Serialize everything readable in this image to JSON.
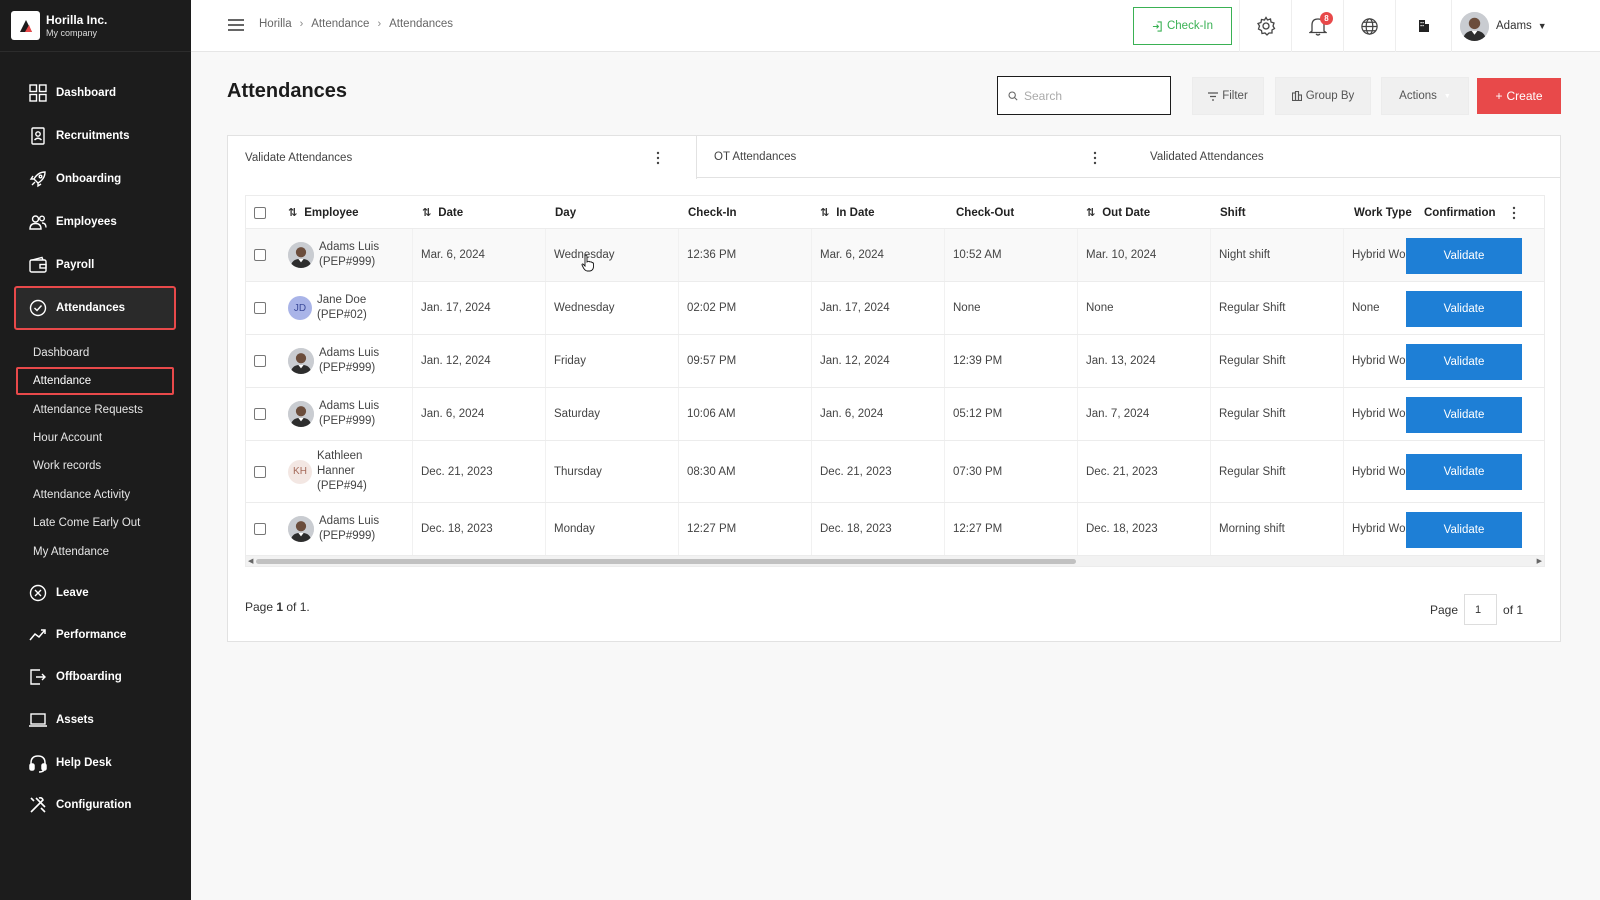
{
  "brand": {
    "company": "Horilla Inc.",
    "subtitle": "My company"
  },
  "sidebar": {
    "items": [
      {
        "label": "Dashboard",
        "icon": "dashboard-icon"
      },
      {
        "label": "Recruitments",
        "icon": "recruitment-icon"
      },
      {
        "label": "Onboarding",
        "icon": "rocket-icon"
      },
      {
        "label": "Employees",
        "icon": "users-icon"
      },
      {
        "label": "Payroll",
        "icon": "wallet-icon"
      },
      {
        "label": "Attendances",
        "icon": "check-circle-icon",
        "active": true
      },
      {
        "label": "Leave",
        "icon": "close-circle-icon"
      },
      {
        "label": "Performance",
        "icon": "trend-icon"
      },
      {
        "label": "Offboarding",
        "icon": "exit-icon"
      },
      {
        "label": "Assets",
        "icon": "laptop-icon"
      },
      {
        "label": "Help Desk",
        "icon": "headset-icon"
      },
      {
        "label": "Configuration",
        "icon": "tools-icon"
      }
    ],
    "attendance_submenu": [
      "Dashboard",
      "Attendance",
      "Attendance Requests",
      "Hour Account",
      "Work records",
      "Attendance Activity",
      "Late Come Early Out",
      "My Attendance"
    ],
    "active_submenu": "Attendance"
  },
  "topbar": {
    "breadcrumb": [
      "Horilla",
      "Attendance",
      "Attendances"
    ],
    "checkin_label": "Check-In",
    "notification_count": "8",
    "user_name": "Adams"
  },
  "page": {
    "title": "Attendances",
    "search_placeholder": "Search",
    "filter_label": "Filter",
    "groupby_label": "Group By",
    "actions_label": "Actions",
    "create_label": "Create"
  },
  "tabs": [
    {
      "label": "Validate Attendances",
      "active": true
    },
    {
      "label": "OT Attendances",
      "active": false
    },
    {
      "label": "Validated Attendances",
      "active": false
    }
  ],
  "table": {
    "columns": [
      "Employee",
      "Date",
      "Day",
      "Check-In",
      "In Date",
      "Check-Out",
      "Out Date",
      "Shift",
      "Work Type",
      "Confirmation"
    ],
    "rows": [
      {
        "name": "Adams Luis",
        "id": "(PEP#999)",
        "avatar": "photo",
        "date": "Mar. 6, 2024",
        "day": "Wednesday",
        "check_in": "12:36 PM",
        "in_date": "Mar. 6, 2024",
        "check_out": "10:52 AM",
        "out_date": "Mar. 10, 2024",
        "shift": "Night shift",
        "work_type": "Hybrid Work",
        "action": "Validate"
      },
      {
        "name": "Jane Doe",
        "id": "(PEP#02)",
        "avatar": "JD",
        "date": "Jan. 17, 2024",
        "day": "Wednesday",
        "check_in": "02:02 PM",
        "in_date": "Jan. 17, 2024",
        "check_out": "None",
        "out_date": "None",
        "shift": "Regular Shift",
        "work_type": "None",
        "action": "Validate"
      },
      {
        "name": "Adams Luis",
        "id": "(PEP#999)",
        "avatar": "photo",
        "date": "Jan. 12, 2024",
        "day": "Friday",
        "check_in": "09:57 PM",
        "in_date": "Jan. 12, 2024",
        "check_out": "12:39 PM",
        "out_date": "Jan. 13, 2024",
        "shift": "Regular Shift",
        "work_type": "Hybrid Work",
        "action": "Validate"
      },
      {
        "name": "Adams Luis",
        "id": "(PEP#999)",
        "avatar": "photo",
        "date": "Jan. 6, 2024",
        "day": "Saturday",
        "check_in": "10:06 AM",
        "in_date": "Jan. 6, 2024",
        "check_out": "05:12 PM",
        "out_date": "Jan. 7, 2024",
        "shift": "Regular Shift",
        "work_type": "Hybrid Work",
        "action": "Validate"
      },
      {
        "name": "Kathleen Hanner",
        "name_line1": "Kathleen",
        "name_line2": "Hanner",
        "id": "(PEP#94)",
        "avatar": "KH",
        "date": "Dec. 21, 2023",
        "day": "Thursday",
        "check_in": "08:30 AM",
        "in_date": "Dec. 21, 2023",
        "check_out": "07:30 PM",
        "out_date": "Dec. 21, 2023",
        "shift": "Regular Shift",
        "work_type": "Hybrid Work",
        "action": "Validate"
      },
      {
        "name": "Adams Luis",
        "id": "(PEP#999)",
        "avatar": "photo",
        "date": "Dec. 18, 2023",
        "day": "Monday",
        "check_in": "12:27 PM",
        "in_date": "Dec. 18, 2023",
        "check_out": "12:27 PM",
        "out_date": "Dec. 18, 2023",
        "shift": "Morning shift",
        "work_type": "Hybrid Work",
        "action": "Validate"
      }
    ]
  },
  "pagination": {
    "summary_prefix": "Page ",
    "summary_current": "1",
    "summary_suffix": " of 1.",
    "page_label": "Page",
    "current_page": "1",
    "of_label": "of 1"
  },
  "colors": {
    "sidebar_bg": "#1c1c1c",
    "accent_red": "#e8494a",
    "validate_blue": "#1e7fd6",
    "checkin_green": "#3ab154"
  }
}
